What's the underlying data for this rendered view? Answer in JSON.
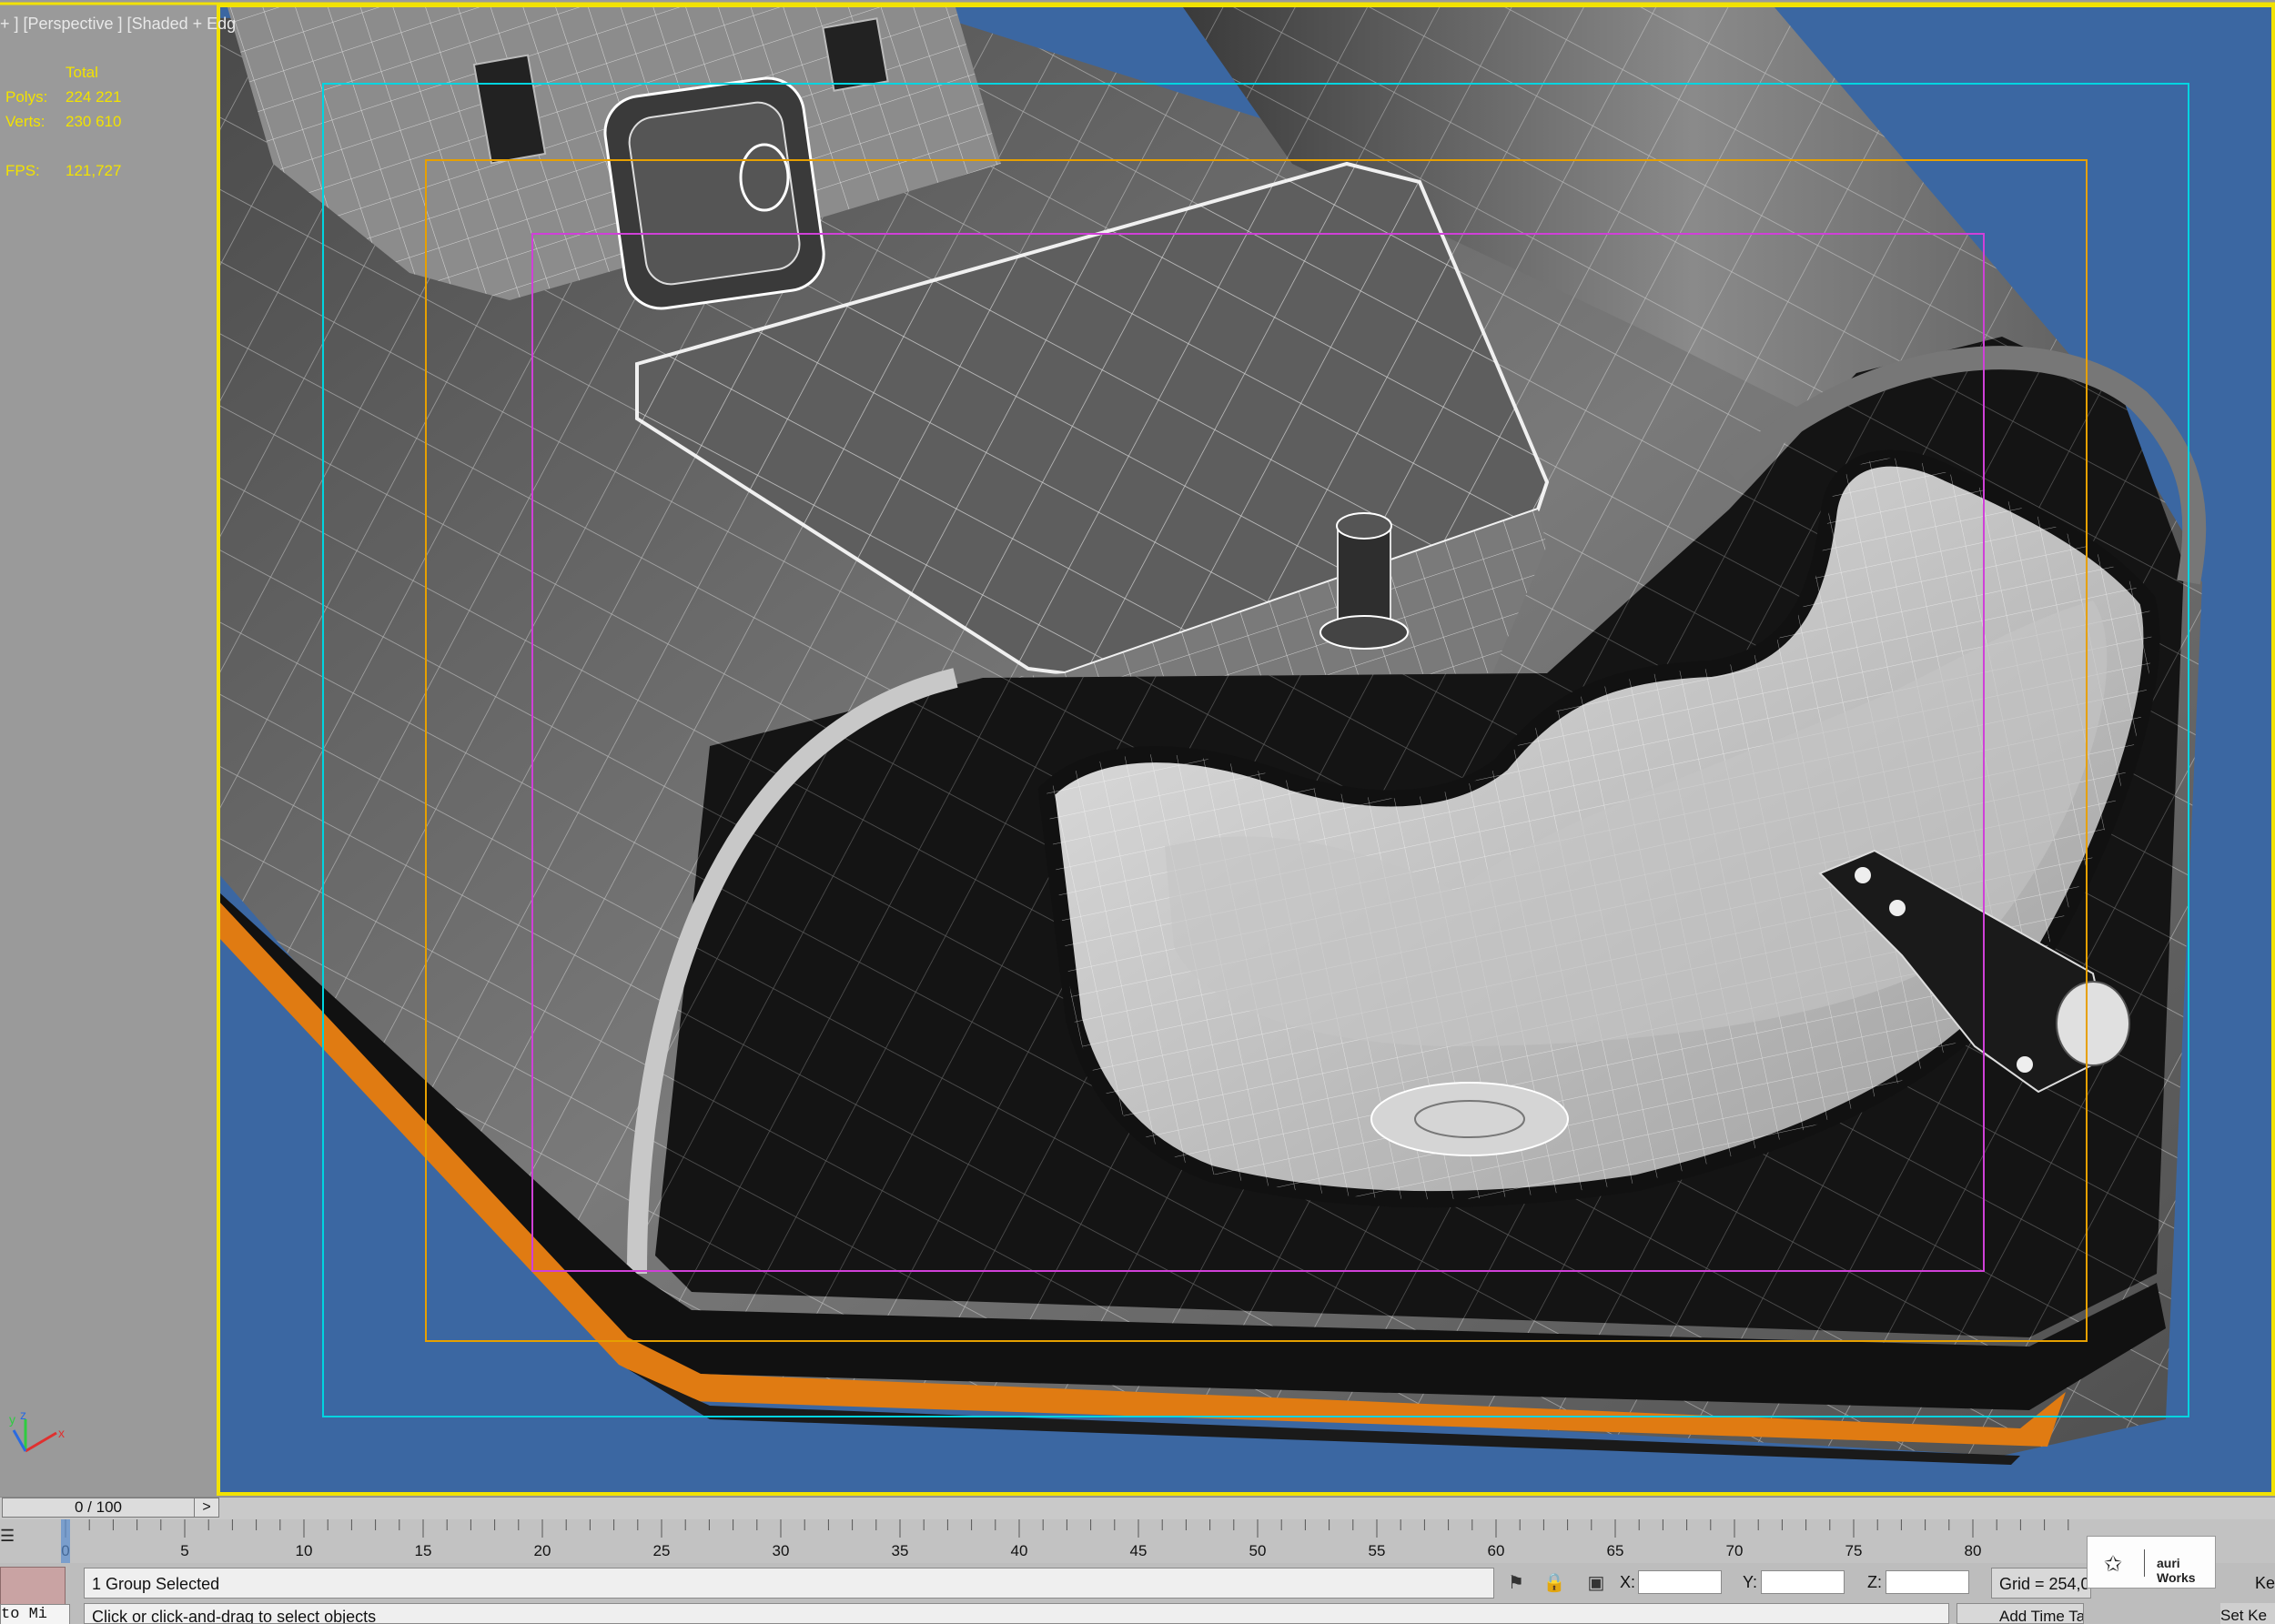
{
  "viewport": {
    "label": "+ ] [Perspective ] [Shaded + Edg"
  },
  "stats": {
    "header": "Total",
    "polys_label": "Polys:",
    "polys_value": "224 221",
    "verts_label": "Verts:",
    "verts_value": "230 610",
    "fps_label": "FPS:",
    "fps_value": "121,727"
  },
  "timeline": {
    "slider_text": "0 / 100",
    "next_label": ">",
    "current_frame": 0,
    "total_frames": 100,
    "ticks": [
      "0",
      "5",
      "10",
      "15",
      "20",
      "25",
      "30",
      "35",
      "40",
      "45",
      "50",
      "55",
      "60",
      "65",
      "70",
      "75",
      "80"
    ]
  },
  "status": {
    "selection": "1 Group Selected",
    "prompt": "Click or click-and-drag to select objects",
    "left_script": "to Mi",
    "x_label": "X:",
    "y_label": "Y:",
    "z_label": "Z:",
    "x_value": "",
    "y_value": "",
    "z_value": "",
    "grid": "Grid = 254,0",
    "add_time_tag": "Add Time Tag",
    "set_key": "Set Ke",
    "key_clip": "Ke"
  },
  "logo": {
    "text": "auri Works"
  },
  "colors": {
    "sky": "#3b67a2",
    "hull": "#5f5f5f",
    "orange_trim": "#e07b12",
    "frame_cyan": "#00d4e0",
    "frame_orange": "#e6a000",
    "frame_magenta": "#d040d8",
    "viewport_border": "#f2e200"
  }
}
